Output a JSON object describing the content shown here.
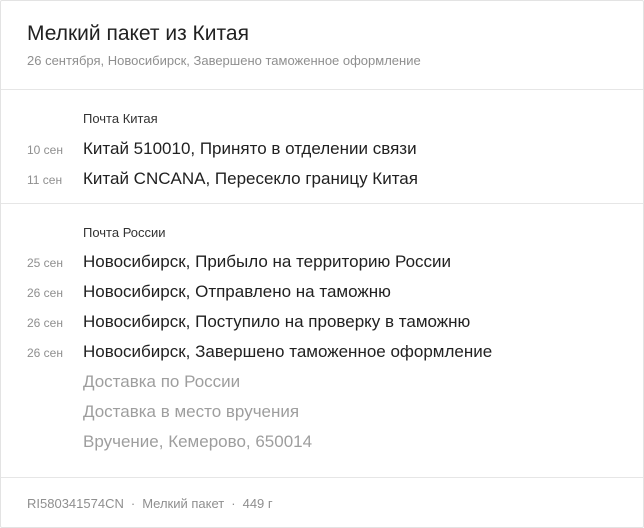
{
  "parcel": {
    "title": "Мелкий пакет из Китая",
    "subtitle": "26 сентября, Новосибирск, Завершено таможенное оформление"
  },
  "sections": [
    {
      "carrier": "Почта Китая",
      "events": [
        {
          "date": "10 сен",
          "text": "Китай 510010, Принято в отделении связи"
        },
        {
          "date": "11 сен",
          "text": "Китай CNCANA, Пересекло границу Китая"
        }
      ]
    },
    {
      "carrier": "Почта России",
      "events": [
        {
          "date": "25 сен",
          "text": "Новосибирск, Прибыло на территорию России"
        },
        {
          "date": "26 сен",
          "text": "Новосибирск, Отправлено на таможню"
        },
        {
          "date": "26 сен",
          "text": "Новосибирск, Поступило на проверку в таможню"
        },
        {
          "date": "26 сен",
          "text": "Новосибирск, Завершено таможенное оформление"
        }
      ],
      "pending": [
        "Доставка по России",
        "Доставка в место вручения",
        "Вручение, Кемерово, 650014"
      ]
    }
  ],
  "footer": {
    "tracking_number": "RI580341574CN",
    "separator": "·",
    "package_type": "Мелкий пакет",
    "weight": "449 г"
  },
  "colors": {
    "primary_text": "#212121",
    "secondary_text": "#8f8f8f",
    "pending_text": "#9e9e9e",
    "divider": "#e6e6e6"
  }
}
